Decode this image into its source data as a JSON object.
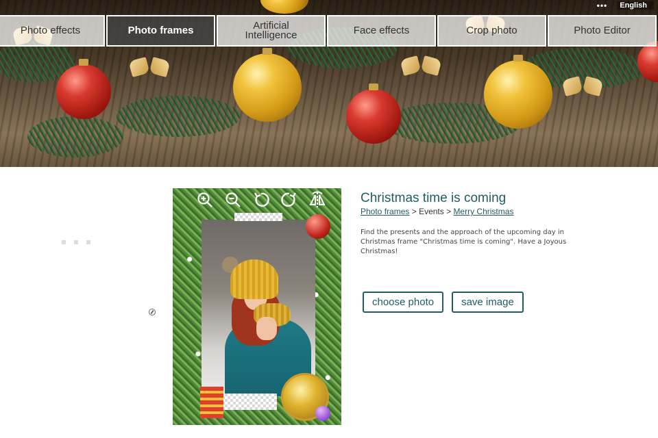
{
  "nav": {
    "items": [
      {
        "label": "Photo effects",
        "active": false
      },
      {
        "label": "Photo frames",
        "active": true
      },
      {
        "label": "Artificial\nIntelligence",
        "active": false
      },
      {
        "label": "Face effects",
        "active": false
      },
      {
        "label": "Crop photo",
        "active": false
      },
      {
        "label": "Photo Editor",
        "active": false
      }
    ]
  },
  "lang": {
    "more_icon": "ellipsis-icon",
    "selected": "English"
  },
  "toolbar": {
    "icons": [
      "zoom-in-icon",
      "zoom-out-icon",
      "rotate-left-icon",
      "rotate-right-icon",
      "flip-icon"
    ]
  },
  "details": {
    "title": "Christmas time is coming",
    "breadcrumb": {
      "category": "Photo frames",
      "sep1": " > ",
      "subcategory": "Events",
      "sep2": " > ",
      "current": "Merry Christmas"
    },
    "description": "Find the presents and the approach of the upcoming day in Christmas frame \"Christmas time is coming\". Have a Joyous Christmas!"
  },
  "buttons": {
    "choose": "choose photo",
    "save": "save image"
  },
  "colors": {
    "accent": "#1e5c61",
    "nav_active_bg": "#464646",
    "nav_bg": "#ffffff"
  }
}
